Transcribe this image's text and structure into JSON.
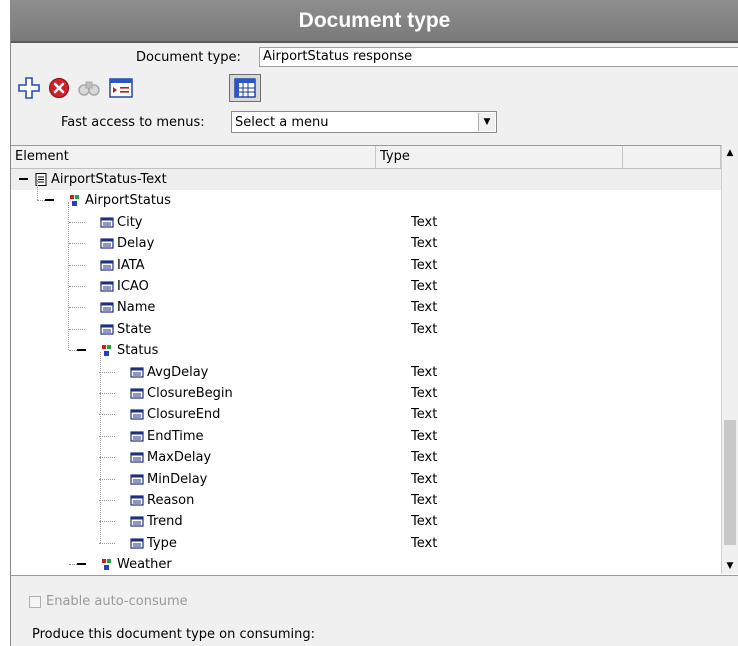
{
  "header": {
    "title": "Document type"
  },
  "doctype": {
    "label": "Document type:",
    "value": "AirportStatus response"
  },
  "toolbar": {
    "buttons": [
      "add-icon",
      "delete-icon",
      "binoculars-icon",
      "properties-icon",
      "table-view-icon"
    ]
  },
  "fast_access": {
    "label": "Fast access to menus:",
    "selected": "Select a menu"
  },
  "tree": {
    "columns": [
      "Element",
      "Type",
      ""
    ],
    "rows": [
      {
        "label": "AirportStatus-Text",
        "type": "",
        "level": 0,
        "kind": "document",
        "expanded": true
      },
      {
        "label": "AirportStatus",
        "type": "",
        "level": 1,
        "kind": "group",
        "expanded": true
      },
      {
        "label": "City",
        "type": "Text",
        "level": 2,
        "kind": "field"
      },
      {
        "label": "Delay",
        "type": "Text",
        "level": 2,
        "kind": "field"
      },
      {
        "label": "IATA",
        "type": "Text",
        "level": 2,
        "kind": "field"
      },
      {
        "label": "ICAO",
        "type": "Text",
        "level": 2,
        "kind": "field"
      },
      {
        "label": "Name",
        "type": "Text",
        "level": 2,
        "kind": "field"
      },
      {
        "label": "State",
        "type": "Text",
        "level": 2,
        "kind": "field"
      },
      {
        "label": "Status",
        "type": "",
        "level": 2,
        "kind": "group",
        "expanded": true
      },
      {
        "label": "AvgDelay",
        "type": "Text",
        "level": 3,
        "kind": "field"
      },
      {
        "label": "ClosureBegin",
        "type": "Text",
        "level": 3,
        "kind": "field"
      },
      {
        "label": "ClosureEnd",
        "type": "Text",
        "level": 3,
        "kind": "field"
      },
      {
        "label": "EndTime",
        "type": "Text",
        "level": 3,
        "kind": "field"
      },
      {
        "label": "MaxDelay",
        "type": "Text",
        "level": 3,
        "kind": "field"
      },
      {
        "label": "MinDelay",
        "type": "Text",
        "level": 3,
        "kind": "field"
      },
      {
        "label": "Reason",
        "type": "Text",
        "level": 3,
        "kind": "field"
      },
      {
        "label": "Trend",
        "type": "Text",
        "level": 3,
        "kind": "field"
      },
      {
        "label": "Type",
        "type": "Text",
        "level": 3,
        "kind": "field"
      },
      {
        "label": "Weather",
        "type": "",
        "level": 2,
        "kind": "group",
        "expanded": true
      }
    ]
  },
  "options": {
    "auto_consume_label": "Enable auto-consume",
    "auto_consume_checked": false,
    "produce_label": "Produce this document type on consuming:"
  },
  "colors": {
    "header": "#7f7f7f",
    "panel": "#f0f0f0",
    "add_icon": "#3a5bc8",
    "delete_icon": "#d2202a"
  }
}
